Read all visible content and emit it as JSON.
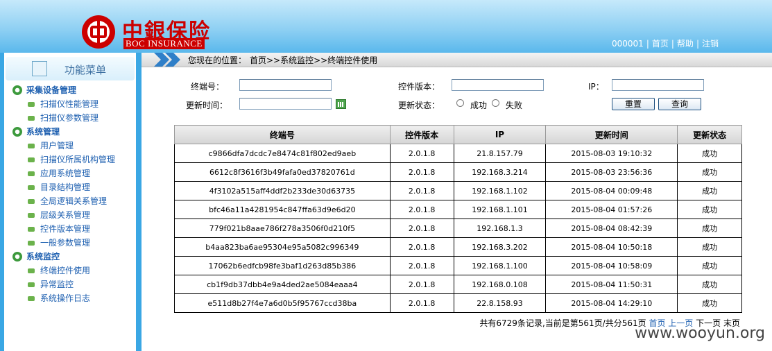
{
  "header": {
    "brand_cn": "中銀保险",
    "brand_en": "BOC INSURANCE",
    "user_id": "000001",
    "links": [
      "首页",
      "帮助",
      "注销"
    ],
    "bg_color": "#5ab8ec"
  },
  "sidebar": {
    "title": "功能菜单",
    "groups": [
      {
        "label": "采集设备管理",
        "items": [
          "扫描仪性能管理",
          "扫描仪参数管理"
        ]
      },
      {
        "label": "系统管理",
        "items": [
          "用户管理",
          "扫描仪所属机构管理",
          "应用系统管理",
          "目录结构管理",
          "全局逻辑关系管理",
          "层级关系管理",
          "控件版本管理",
          "一般参数管理"
        ]
      },
      {
        "label": "系统监控",
        "items": [
          "终端控件使用",
          "异常监控",
          "系统操作日志"
        ]
      }
    ]
  },
  "breadcrumb": {
    "label": "您现在的位置：",
    "path": "首页>>系统监控>>终端控件使用"
  },
  "form": {
    "terminal_label": "终端号：",
    "version_label": "控件版本：",
    "ip_label": "IP：",
    "update_time_label": "更新时间：",
    "status_label": "更新状态：",
    "status_options": [
      "成功",
      "失败"
    ],
    "reset_label": "重置",
    "query_label": "查询"
  },
  "table": {
    "headers": [
      "终端号",
      "控件版本",
      "IP",
      "更新时间",
      "更新状态"
    ],
    "rows": [
      [
        "c9866dfa7dcdc7e8474c81f802ed9aeb",
        "2.0.1.8",
        "21.8.157.79",
        "2015-08-03 19:10:32",
        "成功"
      ],
      [
        "6612c8f3616f3b49fafa0ed37820761d",
        "2.0.1.8",
        "192.168.3.214",
        "2015-08-03 23:56:36",
        "成功"
      ],
      [
        "4f3102a515aff4ddf2b233de30d63735",
        "2.0.1.8",
        "192.168.1.102",
        "2015-08-04 00:09:48",
        "成功"
      ],
      [
        "bfc46a11a4281954c847ffa63d9e6d20",
        "2.0.1.8",
        "192.168.1.101",
        "2015-08-04 01:57:26",
        "成功"
      ],
      [
        "779f021b8aae786f278a3506f0d210f5",
        "2.0.1.8",
        "192.168.1.3",
        "2015-08-04 08:42:39",
        "成功"
      ],
      [
        "b4aa823ba6ae95304e95a5082c996349",
        "2.0.1.8",
        "192.168.3.202",
        "2015-08-04 10:50:18",
        "成功"
      ],
      [
        "17062b6edfcb98fe3baf1d263d85b386",
        "2.0.1.8",
        "192.168.1.100",
        "2015-08-04 10:58:09",
        "成功"
      ],
      [
        "cb1f9db37dbb4e9a4ded2ae5084eaaa4",
        "2.0.1.8",
        "192.168.0.108",
        "2015-08-04 11:50:31",
        "成功"
      ],
      [
        "e511d8b27f4e7a6d0b5f95767ccd38ba",
        "2.0.1.8",
        "22.8.158.93",
        "2015-08-04 14:29:10",
        "成功"
      ]
    ]
  },
  "pager": {
    "summary": "共有6729条记录,当前是第561页/共分561页",
    "first": "首页",
    "prev": "上一页",
    "next": "下一页",
    "last": "末页"
  },
  "watermark": "www.wooyun.org"
}
